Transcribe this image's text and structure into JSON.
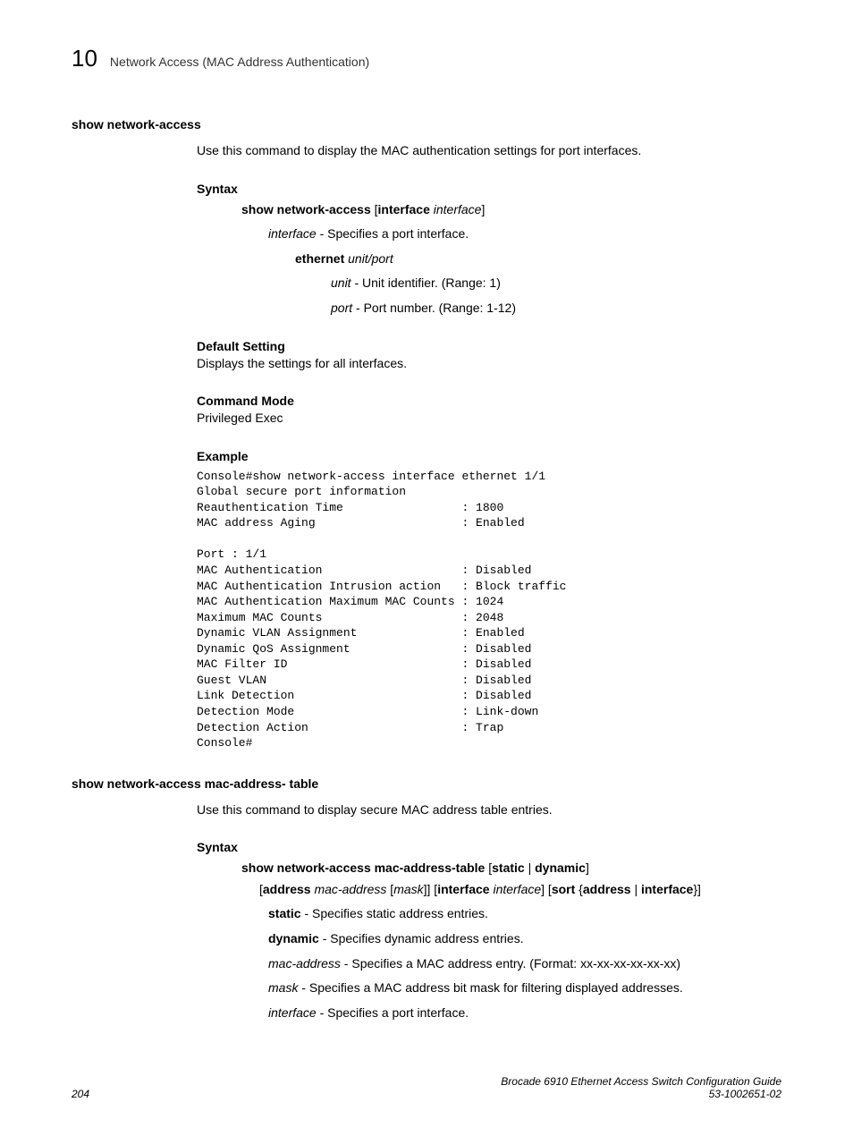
{
  "header": {
    "chapter": "10",
    "title": "Network Access (MAC Address Authentication)"
  },
  "section1": {
    "title": "show network-access",
    "desc": "Use this command to display the MAC authentication settings for port interfaces.",
    "syntax_label": "Syntax",
    "syntax_cmd_b1": "show network-access",
    "syntax_cmd_t1": " [",
    "syntax_cmd_b2": "interface",
    "syntax_cmd_i1": " interface",
    "syntax_cmd_t2": "]",
    "interface_i": "interface",
    "interface_t": " - Specifies a port interface.",
    "ethernet_b": "ethernet",
    "ethernet_i": " unit/port",
    "unit_i": "unit",
    "unit_t": " - Unit identifier. (Range: 1)",
    "port_i": "port",
    "port_t": " - Port number. (Range: 1-12)",
    "default_label": "Default Setting",
    "default_text": "Displays the settings for all interfaces.",
    "mode_label": "Command Mode",
    "mode_text": "Privileged Exec",
    "example_label": "Example",
    "example_code": "Console#show network-access interface ethernet 1/1\nGlobal secure port information\nReauthentication Time                 : 1800\nMAC address Aging                     : Enabled\n\nPort : 1/1\nMAC Authentication                    : Disabled\nMAC Authentication Intrusion action   : Block traffic\nMAC Authentication Maximum MAC Counts : 1024\nMaximum MAC Counts                    : 2048\nDynamic VLAN Assignment               : Enabled\nDynamic QoS Assignment                : Disabled\nMAC Filter ID                         : Disabled\nGuest VLAN                            : Disabled\nLink Detection                        : Disabled\nDetection Mode                        : Link-down\nDetection Action                      : Trap\nConsole#"
  },
  "section2": {
    "title": "show network-access mac-address- table",
    "desc": "Use this command to display secure MAC address table entries.",
    "syntax_label": "Syntax",
    "s_b1": "show network-access mac-address-table",
    "s_t1": " [",
    "s_b2": "static",
    "s_t2": " | ",
    "s_b3": "dynamic",
    "s_t3": "]",
    "l2_t1": "[",
    "l2_b1": "address",
    "l2_i1": " mac-address",
    "l2_t2": " [",
    "l2_i2": "mask",
    "l2_t3": "]] [",
    "l2_b2": "interface",
    "l2_i3": " interface",
    "l2_t4": "] [",
    "l2_b3": "sort",
    "l2_t5": " {",
    "l2_b4": "address",
    "l2_t6": " | ",
    "l2_b5": "interface",
    "l2_t7": "}]",
    "static_b": "static",
    "static_t": " - Specifies static address entries.",
    "dynamic_b": "dynamic",
    "dynamic_t": " - Specifies dynamic address entries.",
    "mac_i": "mac-address",
    "mac_t": " - Specifies a MAC address entry. (Format: xx-xx-xx-xx-xx-xx)",
    "mask_i": "mask",
    "mask_t": " - Specifies a MAC address bit mask for filtering displayed addresses.",
    "iface_i": "interface",
    "iface_t": " - Specifies a port interface."
  },
  "footer": {
    "page": "204",
    "doc": "Brocade 6910 Ethernet Access Switch Configuration Guide",
    "docnum": "53-1002651-02"
  }
}
